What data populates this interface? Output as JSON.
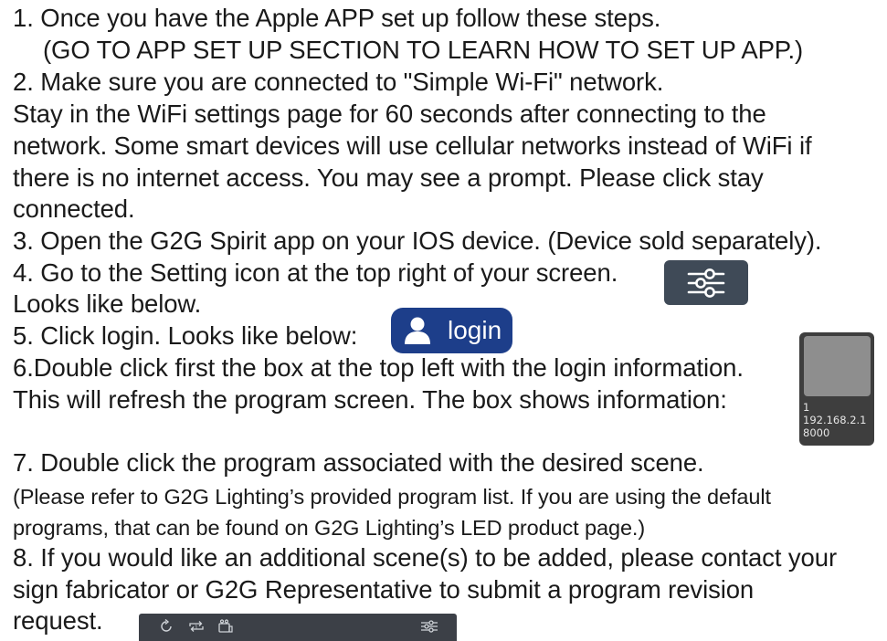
{
  "lines": {
    "l1": "1. Once you have the Apple APP set up follow these steps.",
    "l1b": "(GO TO APP SET UP SECTION TO LEARN HOW TO SET UP APP.)",
    "l2": "2. Make sure you are connected to \"Simple Wi-Fi\" network.",
    "l2a": "Stay in the WiFi settings page for 60 seconds after connecting to the",
    "l2b": "network. Some smart devices will use cellular networks instead of WiFi if",
    "l2c": "there is no internet access. You may see a prompt. Please click stay",
    "l2d": "connected.",
    "l3": "3. Open the G2G Spirit app on your IOS device. (Device sold separately).",
    "l4": "4. Go to the Setting icon at the top right of your screen.",
    "l4b": "Looks like below.",
    "l5": "5. Click login.  Looks like below:",
    "l6": "6.Double click first the box at the top left with the login information.",
    "l6b": "This will refresh the program screen. The box shows information:",
    "l7": "7. Double click the program associated with the desired scene.",
    "l7a": "(Please refer to G2G Lighting’s provided program list. If you are using the default",
    "l7b": "programs, that can be found on G2G Lighting’s LED product page.)",
    "l8": "8. If you would like an additional scene(s) to be added, please contact your",
    "l8b": "sign fabricator or G2G Representative to submit a program revision",
    "l8c": "request."
  },
  "settings_button": {
    "icon": "sliders-icon",
    "color": "#3f4a57"
  },
  "login_button": {
    "label": "login",
    "icon": "user-icon",
    "color": "#1d3e8a"
  },
  "device_box": {
    "id": "1",
    "ip": "192.168.2.1",
    "port": "8000"
  },
  "app_toolbar": {
    "icons": [
      "refresh-icon",
      "repeat-one-icon",
      "devices-icon",
      "sliders-icon"
    ],
    "color": "#3c4047"
  }
}
